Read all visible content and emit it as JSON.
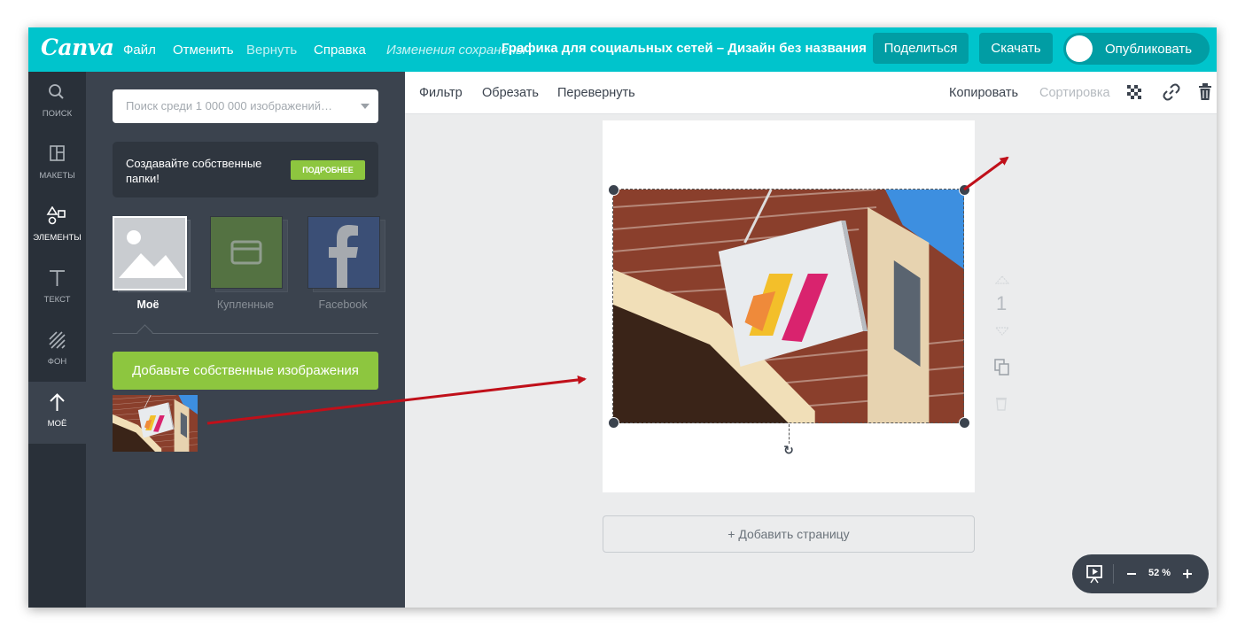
{
  "app": {
    "logo": "Canva"
  },
  "topbar": {
    "menu": [
      "Файл",
      "Отменить",
      "Вернуть",
      "Справка"
    ],
    "saved_status": "Изменения сохранены",
    "doc_title": "Графика для социальных сетей – Дизайн без названия",
    "share_label": "Поделиться",
    "download_label": "Скачать",
    "publish_label": "Опубликовать"
  },
  "rail": [
    {
      "label": "ПОИСК",
      "icon": "search-icon"
    },
    {
      "label": "МАКЕТЫ",
      "icon": "layouts-icon"
    },
    {
      "label": "ЭЛЕМЕНТЫ",
      "icon": "elements-icon"
    },
    {
      "label": "ТЕКСТ",
      "icon": "text-icon"
    },
    {
      "label": "ФОН",
      "icon": "background-icon"
    },
    {
      "label": "МОЁ",
      "icon": "upload-icon"
    }
  ],
  "panel": {
    "search_placeholder": "Поиск среди 1 000 000 изображений…",
    "promo_text": "Создавайте собственные папки!",
    "promo_button": "ПОДРОБНЕЕ",
    "folders": [
      {
        "label": "Моё",
        "icon": "image-placeholder-icon"
      },
      {
        "label": "Купленные",
        "icon": "card-icon"
      },
      {
        "label": "Facebook",
        "icon": "facebook-icon"
      }
    ],
    "upload_button": "Добавьте собственные изображения"
  },
  "editor_toolbar": {
    "filter": "Фильтр",
    "crop": "Обрезать",
    "flip": "Перевернуть",
    "copy": "Копировать",
    "sort": "Сортировка"
  },
  "canvas": {
    "page_number": "1",
    "add_page": "+ Добавить страницу",
    "zoom": "52 %"
  },
  "colors": {
    "brand": "#00c4cc",
    "accent_green": "#8dc63f",
    "panel": "#3b434e",
    "rail": "#293039",
    "arrow": "#c0101a"
  }
}
